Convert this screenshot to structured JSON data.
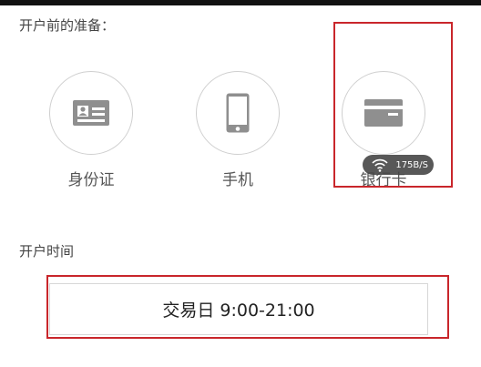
{
  "prep": {
    "title": "开户前的准备：",
    "items": [
      {
        "label": "身份证",
        "icon": "id-card-icon"
      },
      {
        "label": "手机",
        "icon": "mobile-phone-icon"
      },
      {
        "label": "银行卡",
        "icon": "bank-card-icon"
      }
    ]
  },
  "network": {
    "speed": "175B/S",
    "icon": "wifi-icon"
  },
  "hours": {
    "title": "开户时间",
    "value": "交易日 9:00-21:00"
  },
  "colors": {
    "highlight": "#c9262b",
    "icon_gray": "#8f8f8f",
    "circle_border": "#cfcfcf"
  }
}
